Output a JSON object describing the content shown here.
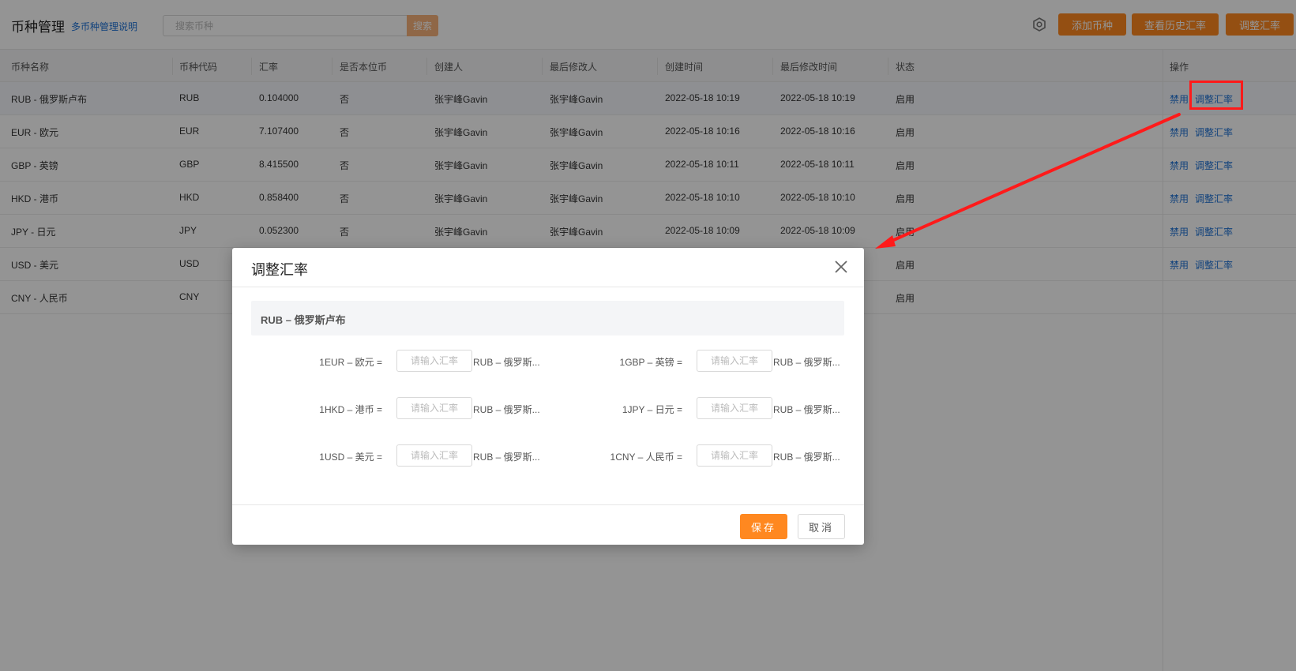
{
  "header": {
    "title": "币种管理",
    "help_link": "多币种管理说明",
    "search_placeholder": "搜索币种",
    "search_button": "搜索",
    "add_currency": "添加币种",
    "view_history": "查看历史汇率",
    "adjust_rate": "调整汇率"
  },
  "table": {
    "columns": [
      "币种名称",
      "币种代码",
      "汇率",
      "是否本位币",
      "创建人",
      "最后修改人",
      "创建时间",
      "最后修改时间",
      "状态",
      "操作"
    ],
    "rows": [
      {
        "name": "RUB - 俄罗斯卢布",
        "code": "RUB",
        "rate": "0.104000",
        "base": "否",
        "creator": "张宇峰Gavin",
        "modifier": "张宇峰Gavin",
        "created": "2022-05-18 10:19",
        "modified": "2022-05-18 10:19",
        "status": "启用",
        "op_disable": "禁用",
        "op_adjust": "调整汇率"
      },
      {
        "name": "EUR - 欧元",
        "code": "EUR",
        "rate": "7.107400",
        "base": "否",
        "creator": "张宇峰Gavin",
        "modifier": "张宇峰Gavin",
        "created": "2022-05-18 10:16",
        "modified": "2022-05-18 10:16",
        "status": "启用",
        "op_disable": "禁用",
        "op_adjust": "调整汇率"
      },
      {
        "name": "GBP - 英镑",
        "code": "GBP",
        "rate": "8.415500",
        "base": "否",
        "creator": "张宇峰Gavin",
        "modifier": "张宇峰Gavin",
        "created": "2022-05-18 10:11",
        "modified": "2022-05-18 10:11",
        "status": "启用",
        "op_disable": "禁用",
        "op_adjust": "调整汇率"
      },
      {
        "name": "HKD - 港币",
        "code": "HKD",
        "rate": "0.858400",
        "base": "否",
        "creator": "张宇峰Gavin",
        "modifier": "张宇峰Gavin",
        "created": "2022-05-18 10:10",
        "modified": "2022-05-18 10:10",
        "status": "启用",
        "op_disable": "禁用",
        "op_adjust": "调整汇率"
      },
      {
        "name": "JPY - 日元",
        "code": "JPY",
        "rate": "0.052300",
        "base": "否",
        "creator": "张宇峰Gavin",
        "modifier": "张宇峰Gavin",
        "created": "2022-05-18 10:09",
        "modified": "2022-05-18 10:09",
        "status": "启用",
        "op_disable": "禁用",
        "op_adjust": "调整汇率"
      },
      {
        "name": "USD - 美元",
        "code": "USD",
        "rate": "",
        "base": "",
        "creator": "",
        "modifier": "",
        "created": "",
        "modified": "",
        "status": "启用",
        "op_disable": "禁用",
        "op_adjust": "调整汇率"
      },
      {
        "name": "CNY - 人民币",
        "code": "CNY",
        "rate": "",
        "base": "",
        "creator": "",
        "modifier": "",
        "created": "",
        "modified": "",
        "status": "启用",
        "op_disable": "",
        "op_adjust": ""
      }
    ]
  },
  "modal": {
    "title": "调整汇率",
    "section": "RUB – 俄罗斯卢布",
    "rate_placeholder": "请输入汇率",
    "rates": [
      {
        "label": "1EUR – 欧元 =",
        "unit": "RUB – 俄罗斯..."
      },
      {
        "label": "1GBP – 英镑 =",
        "unit": "RUB – 俄罗斯..."
      },
      {
        "label": "1HKD – 港币 =",
        "unit": "RUB – 俄罗斯..."
      },
      {
        "label": "1JPY – 日元 =",
        "unit": "RUB – 俄罗斯..."
      },
      {
        "label": "1USD – 美元 =",
        "unit": "RUB – 俄罗斯..."
      },
      {
        "label": "1CNY – 人民币 =",
        "unit": "RUB – 俄罗斯..."
      }
    ],
    "save": "保存",
    "cancel": "取消"
  },
  "colors": {
    "accent": "#ff8820",
    "link": "#1f73d6",
    "annotation": "#ff1a1a"
  }
}
